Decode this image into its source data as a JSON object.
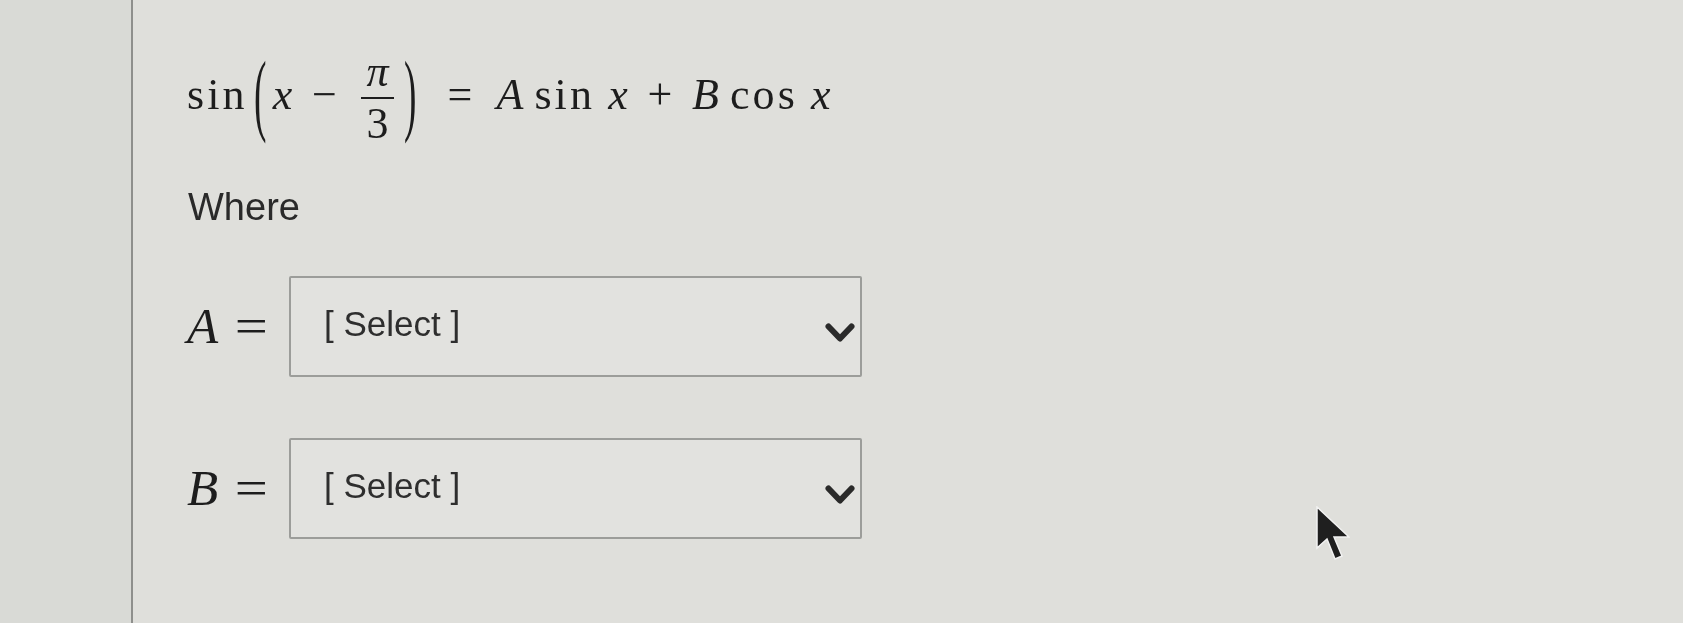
{
  "equation": {
    "tokens": [
      {
        "kind": "fn",
        "text": "sin"
      },
      {
        "kind": "paren",
        "text": "("
      },
      {
        "kind": "var",
        "text": "x"
      },
      {
        "kind": "op",
        "text": "−"
      },
      {
        "kind": "frac",
        "numerator": {
          "kind": "var",
          "text": "π"
        },
        "denominator": {
          "kind": "num",
          "text": "3"
        }
      },
      {
        "kind": "paren",
        "text": ")"
      },
      {
        "kind": "rel",
        "text": "="
      },
      {
        "kind": "var",
        "text": "A"
      },
      {
        "kind": "fn",
        "text": "sin"
      },
      {
        "kind": "var",
        "text": "x"
      },
      {
        "kind": "op",
        "text": "+"
      },
      {
        "kind": "var",
        "text": "B"
      },
      {
        "kind": "fn",
        "text": "cos"
      },
      {
        "kind": "var",
        "text": "x"
      }
    ]
  },
  "intro_text": "Where",
  "fields": [
    {
      "variable": "A",
      "equals": "=",
      "value": "[ Select ]"
    },
    {
      "variable": "B",
      "equals": "=",
      "value": "[ Select ]"
    }
  ]
}
